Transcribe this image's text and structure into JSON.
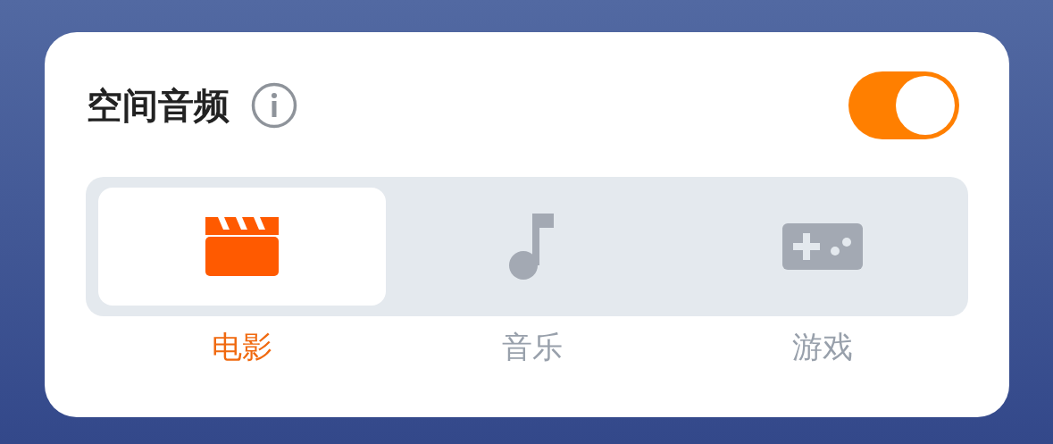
{
  "title": "空间音频",
  "toggle": {
    "on": true
  },
  "modes": [
    {
      "kind": "movie",
      "label": "电影",
      "selected": true
    },
    {
      "kind": "music",
      "label": "音乐",
      "selected": false
    },
    {
      "kind": "game",
      "label": "游戏",
      "selected": false
    }
  ]
}
